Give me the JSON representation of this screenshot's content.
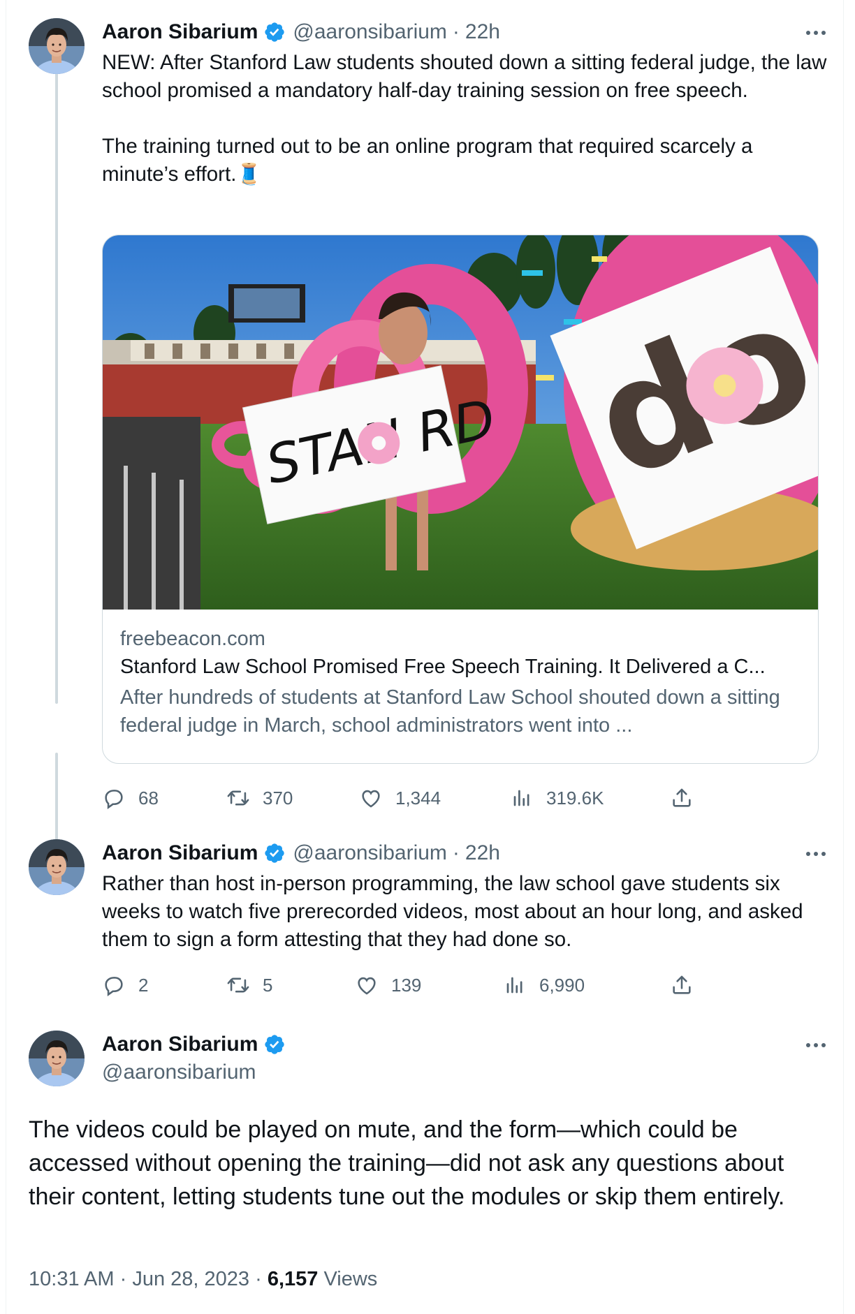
{
  "author": {
    "name": "Aaron Sibarium",
    "handle": "@aaronsibarium",
    "verified": true,
    "verified_color": "#1d9bf0"
  },
  "tweets": [
    {
      "time": "22h",
      "paragraphs": [
        "NEW: After Stanford Law students shouted down a sitting federal judge, the law school promised a mandatory half-day training session on free speech.",
        "The training turned out to be an online program that required scarcely a minute’s effort.🧵"
      ],
      "card": {
        "image_icon": "stanford-donut-photo",
        "domain": "freebeacon.com",
        "title": "Stanford Law School Promised Free Speech Training. It Delivered a C...",
        "description": "After hundreds of students at Stanford Law School shouted down a sitting federal judge in March, school administrators went into ..."
      },
      "stats": {
        "replies": "68",
        "reposts": "370",
        "likes": "1,344",
        "views": "319.6K"
      }
    },
    {
      "time": "22h",
      "paragraphs": [
        "Rather than host in-person programming, the law school gave students six weeks to watch five prerecorded videos, most about an hour long, and asked them to sign a form attesting that they had done so."
      ],
      "stats": {
        "replies": "2",
        "reposts": "5",
        "likes": "139",
        "views": "6,990"
      }
    }
  ],
  "main_tweet": {
    "text": "The videos could be played on mute, and the form—which could be accessed without opening the training—did not ask any questions about their content, letting students tune out the modules or skip them entirely.",
    "time": "10:31 AM",
    "date": "Jun 28, 2023",
    "separator": "·",
    "views_count": "6,157",
    "views_label": "Views"
  },
  "colors": {
    "text": "#0f1419",
    "secondary": "#536471",
    "border": "#cfd9de",
    "thread_line": "#cfd9de"
  }
}
